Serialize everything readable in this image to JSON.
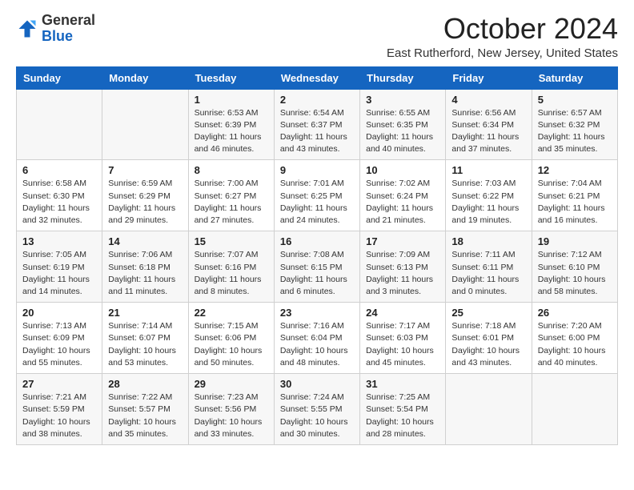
{
  "header": {
    "logo_general": "General",
    "logo_blue": "Blue",
    "month_title": "October 2024",
    "location": "East Rutherford, New Jersey, United States"
  },
  "days_of_week": [
    "Sunday",
    "Monday",
    "Tuesday",
    "Wednesday",
    "Thursday",
    "Friday",
    "Saturday"
  ],
  "weeks": [
    [
      {
        "day": "",
        "info": ""
      },
      {
        "day": "",
        "info": ""
      },
      {
        "day": "1",
        "info": "Sunrise: 6:53 AM\nSunset: 6:39 PM\nDaylight: 11 hours and 46 minutes."
      },
      {
        "day": "2",
        "info": "Sunrise: 6:54 AM\nSunset: 6:37 PM\nDaylight: 11 hours and 43 minutes."
      },
      {
        "day": "3",
        "info": "Sunrise: 6:55 AM\nSunset: 6:35 PM\nDaylight: 11 hours and 40 minutes."
      },
      {
        "day": "4",
        "info": "Sunrise: 6:56 AM\nSunset: 6:34 PM\nDaylight: 11 hours and 37 minutes."
      },
      {
        "day": "5",
        "info": "Sunrise: 6:57 AM\nSunset: 6:32 PM\nDaylight: 11 hours and 35 minutes."
      }
    ],
    [
      {
        "day": "6",
        "info": "Sunrise: 6:58 AM\nSunset: 6:30 PM\nDaylight: 11 hours and 32 minutes."
      },
      {
        "day": "7",
        "info": "Sunrise: 6:59 AM\nSunset: 6:29 PM\nDaylight: 11 hours and 29 minutes."
      },
      {
        "day": "8",
        "info": "Sunrise: 7:00 AM\nSunset: 6:27 PM\nDaylight: 11 hours and 27 minutes."
      },
      {
        "day": "9",
        "info": "Sunrise: 7:01 AM\nSunset: 6:25 PM\nDaylight: 11 hours and 24 minutes."
      },
      {
        "day": "10",
        "info": "Sunrise: 7:02 AM\nSunset: 6:24 PM\nDaylight: 11 hours and 21 minutes."
      },
      {
        "day": "11",
        "info": "Sunrise: 7:03 AM\nSunset: 6:22 PM\nDaylight: 11 hours and 19 minutes."
      },
      {
        "day": "12",
        "info": "Sunrise: 7:04 AM\nSunset: 6:21 PM\nDaylight: 11 hours and 16 minutes."
      }
    ],
    [
      {
        "day": "13",
        "info": "Sunrise: 7:05 AM\nSunset: 6:19 PM\nDaylight: 11 hours and 14 minutes."
      },
      {
        "day": "14",
        "info": "Sunrise: 7:06 AM\nSunset: 6:18 PM\nDaylight: 11 hours and 11 minutes."
      },
      {
        "day": "15",
        "info": "Sunrise: 7:07 AM\nSunset: 6:16 PM\nDaylight: 11 hours and 8 minutes."
      },
      {
        "day": "16",
        "info": "Sunrise: 7:08 AM\nSunset: 6:15 PM\nDaylight: 11 hours and 6 minutes."
      },
      {
        "day": "17",
        "info": "Sunrise: 7:09 AM\nSunset: 6:13 PM\nDaylight: 11 hours and 3 minutes."
      },
      {
        "day": "18",
        "info": "Sunrise: 7:11 AM\nSunset: 6:11 PM\nDaylight: 11 hours and 0 minutes."
      },
      {
        "day": "19",
        "info": "Sunrise: 7:12 AM\nSunset: 6:10 PM\nDaylight: 10 hours and 58 minutes."
      }
    ],
    [
      {
        "day": "20",
        "info": "Sunrise: 7:13 AM\nSunset: 6:09 PM\nDaylight: 10 hours and 55 minutes."
      },
      {
        "day": "21",
        "info": "Sunrise: 7:14 AM\nSunset: 6:07 PM\nDaylight: 10 hours and 53 minutes."
      },
      {
        "day": "22",
        "info": "Sunrise: 7:15 AM\nSunset: 6:06 PM\nDaylight: 10 hours and 50 minutes."
      },
      {
        "day": "23",
        "info": "Sunrise: 7:16 AM\nSunset: 6:04 PM\nDaylight: 10 hours and 48 minutes."
      },
      {
        "day": "24",
        "info": "Sunrise: 7:17 AM\nSunset: 6:03 PM\nDaylight: 10 hours and 45 minutes."
      },
      {
        "day": "25",
        "info": "Sunrise: 7:18 AM\nSunset: 6:01 PM\nDaylight: 10 hours and 43 minutes."
      },
      {
        "day": "26",
        "info": "Sunrise: 7:20 AM\nSunset: 6:00 PM\nDaylight: 10 hours and 40 minutes."
      }
    ],
    [
      {
        "day": "27",
        "info": "Sunrise: 7:21 AM\nSunset: 5:59 PM\nDaylight: 10 hours and 38 minutes."
      },
      {
        "day": "28",
        "info": "Sunrise: 7:22 AM\nSunset: 5:57 PM\nDaylight: 10 hours and 35 minutes."
      },
      {
        "day": "29",
        "info": "Sunrise: 7:23 AM\nSunset: 5:56 PM\nDaylight: 10 hours and 33 minutes."
      },
      {
        "day": "30",
        "info": "Sunrise: 7:24 AM\nSunset: 5:55 PM\nDaylight: 10 hours and 30 minutes."
      },
      {
        "day": "31",
        "info": "Sunrise: 7:25 AM\nSunset: 5:54 PM\nDaylight: 10 hours and 28 minutes."
      },
      {
        "day": "",
        "info": ""
      },
      {
        "day": "",
        "info": ""
      }
    ]
  ]
}
